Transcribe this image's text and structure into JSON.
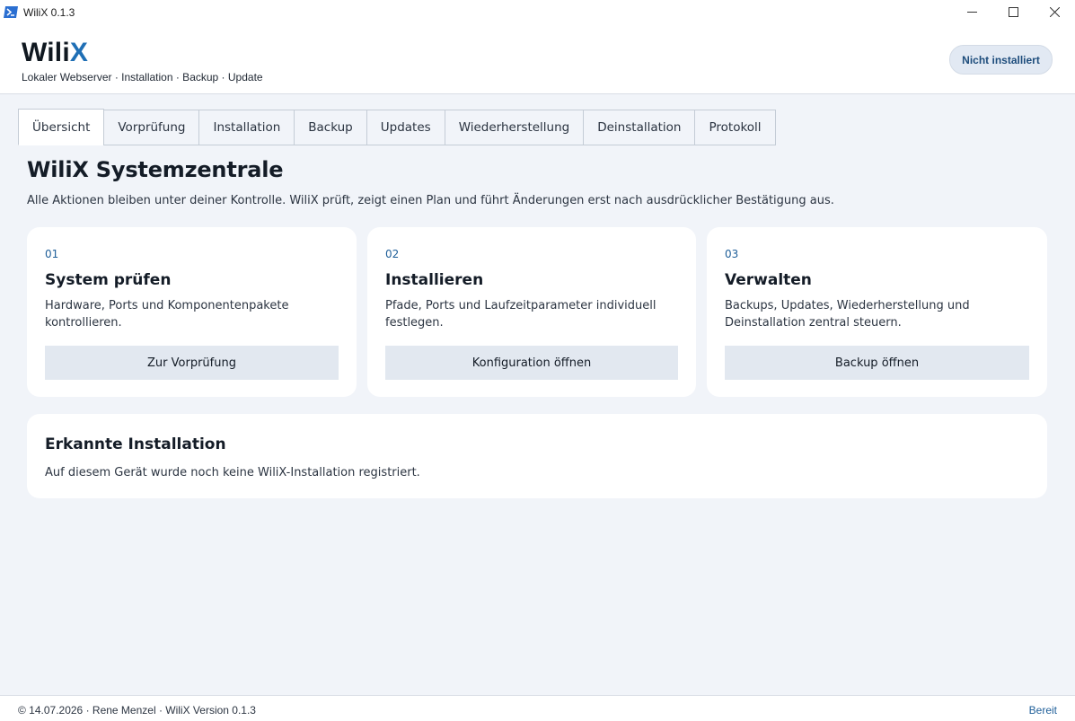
{
  "window": {
    "title": "WiliX 0.1.3"
  },
  "header": {
    "brand_main": "Wili",
    "brand_accent": "X",
    "subtitle": "Lokaler Webserver · Installation · Backup · Update",
    "status": "Nicht installiert"
  },
  "tabs": [
    {
      "label": "Übersicht",
      "active": true
    },
    {
      "label": "Vorprüfung",
      "active": false
    },
    {
      "label": "Installation",
      "active": false
    },
    {
      "label": "Backup",
      "active": false
    },
    {
      "label": "Updates",
      "active": false
    },
    {
      "label": "Wiederherstellung",
      "active": false
    },
    {
      "label": "Deinstallation",
      "active": false
    },
    {
      "label": "Protokoll",
      "active": false
    }
  ],
  "main": {
    "title": "WiliX Systemzentrale",
    "description": "Alle Aktionen bleiben unter deiner Kontrolle. WiliX prüft, zeigt einen Plan und führt Änderungen erst nach ausdrücklicher Bestätigung aus.",
    "cards": [
      {
        "number": "01",
        "title": "System prüfen",
        "text_line1": "Hardware, Ports und Komponentenpakete",
        "text_line2": "kontrollieren.",
        "button": "Zur Vorprüfung"
      },
      {
        "number": "02",
        "title": "Installieren",
        "text_line1": "Pfade, Ports und Laufzeitparameter individuell",
        "text_line2": "festlegen.",
        "button": "Konfiguration öffnen"
      },
      {
        "number": "03",
        "title": "Verwalten",
        "text_line1": "Backups, Updates, Wiederherstellung und",
        "text_line2": "Deinstallation zentral steuern.",
        "button": "Backup öffnen"
      }
    ],
    "installation": {
      "title": "Erkannte Installation",
      "text": "Auf diesem Gerät wurde noch keine WiliX-Installation registriert."
    }
  },
  "footer": {
    "left": "© 14.07.2026 · Rene Menzel · WiliX Version 0.1.3",
    "right": "Bereit"
  },
  "colors": {
    "accent": "#1f6fb5",
    "background": "#f1f4f9",
    "card": "#ffffff",
    "button": "#e2e8f0"
  }
}
